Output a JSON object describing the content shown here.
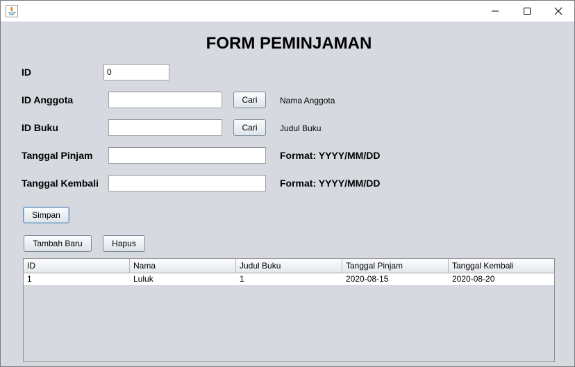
{
  "window": {
    "title": "",
    "controls": {
      "minimize": "minimize-icon",
      "maximize": "maximize-icon",
      "close": "close-icon"
    }
  },
  "form": {
    "title": "FORM PEMINJAMAN",
    "id_label": "ID",
    "id_value": "0",
    "id_anggota_label": "ID Anggota",
    "id_anggota_value": "",
    "cari_label": "Cari",
    "nama_anggota": "Nama Anggota",
    "id_buku_label": "ID Buku",
    "id_buku_value": "",
    "judul_buku": "Judul Buku",
    "tanggal_pinjam_label": "Tanggal Pinjam",
    "tanggal_pinjam_value": "",
    "tanggal_kembali_label": "Tanggal Kembali",
    "tanggal_kembali_value": "",
    "format_hint": "Format: YYYY/MM/DD"
  },
  "buttons": {
    "simpan": "Simpan",
    "tambah_baru": "Tambah Baru",
    "hapus": "Hapus"
  },
  "table": {
    "columns": [
      "ID",
      "Nama",
      "Judul Buku",
      "Tanggal Pinjam",
      "Tanggal Kembali"
    ],
    "rows": [
      [
        "1",
        "Luluk",
        "1",
        "2020-08-15",
        "2020-08-20"
      ]
    ]
  },
  "colors": {
    "background": "#d6d9df",
    "titlebar": "#ffffff",
    "java_icon_orange": "#e76f00",
    "java_icon_blue": "#5382a1"
  }
}
